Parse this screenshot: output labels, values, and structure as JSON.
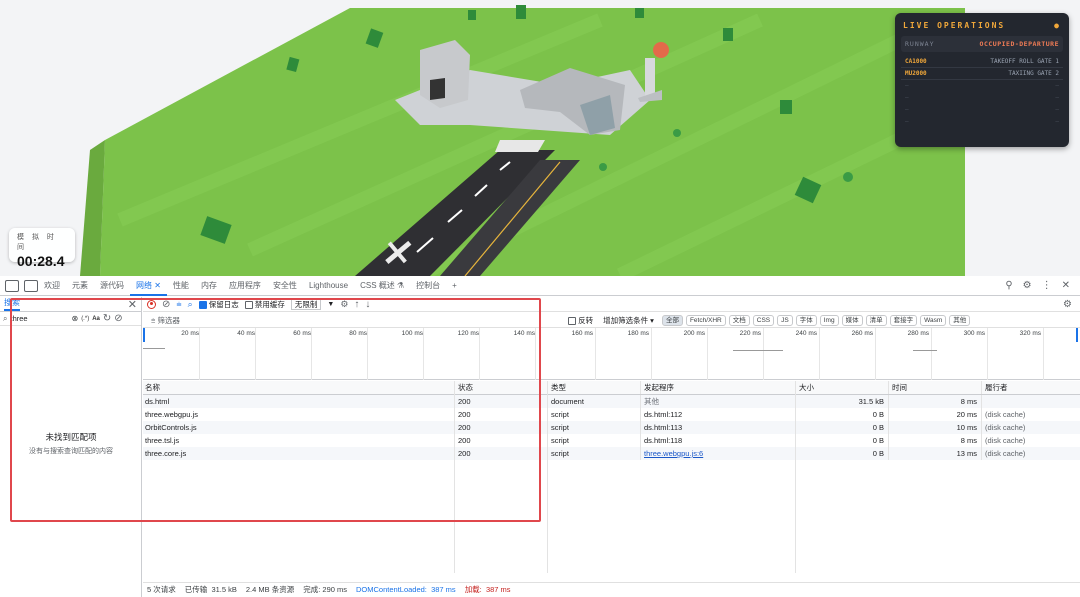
{
  "scene": {
    "sim_time_label": "模 拟 时 间",
    "sim_time_value": "00:28.4",
    "ops": {
      "title": "LIVE OPERATIONS",
      "runway_label": "RUNWAY",
      "runway_status": "OCCUPIED-DEPARTURE",
      "flights": [
        {
          "id": "CA1000",
          "status": "TAKEOFF ROLL GATE 1"
        },
        {
          "id": "MU2000",
          "status": "TAXIING GATE 2"
        }
      ],
      "empty_slot": "—",
      "empty_slot_right": "—"
    },
    "colors": {
      "grass": "#7cc24a",
      "runway": "#2f2f33",
      "panel": "#23272f",
      "accent": "#f0a73a"
    }
  },
  "devtools": {
    "tabs": [
      "欢迎",
      "元素",
      "源代码",
      "网络",
      "性能",
      "内存",
      "应用程序",
      "安全性",
      "Lighthouse",
      "CSS 概述",
      "控制台"
    ],
    "active_tab_index": 3,
    "search": {
      "title": "搜索",
      "query": "three",
      "regex": "(.*)",
      "case": "Aa",
      "empty_title": "未找到匹配项",
      "empty_desc": "没有与搜索查询匹配的内容"
    },
    "toolbar": {
      "preserve_log": "保留日志",
      "disable_cache": "禁用缓存",
      "throttle": "无限制"
    },
    "filter": {
      "placeholder": "筛选器",
      "invert": "反转",
      "more_filters": "增加筛选条件",
      "chips": [
        "全部",
        "Fetch/XHR",
        "文档",
        "CSS",
        "JS",
        "字体",
        "Img",
        "媒体",
        "清单",
        "套接字",
        "Wasm",
        "其他"
      ]
    },
    "timeline_ticks": [
      "20 ms",
      "40 ms",
      "60 ms",
      "80 ms",
      "100 ms",
      "120 ms",
      "140 ms",
      "160 ms",
      "180 ms",
      "200 ms",
      "220 ms",
      "240 ms",
      "260 ms",
      "280 ms",
      "300 ms",
      "320 ms"
    ],
    "columns": {
      "name": "名称",
      "status": "状态",
      "type": "类型",
      "initiator": "发起程序",
      "size": "大小",
      "time": "时间",
      "fulfilled": "履行者"
    },
    "rows": [
      {
        "name": "ds.html",
        "status": "200",
        "type": "document",
        "initiator": "其他",
        "size": "31.5 kB",
        "time": "8 ms",
        "fulfilled": ""
      },
      {
        "name": "three.webgpu.js",
        "status": "200",
        "type": "script",
        "initiator": "ds.html:112",
        "size": "0 B",
        "time": "20 ms",
        "fulfilled": "(disk cache)"
      },
      {
        "name": "OrbitControls.js",
        "status": "200",
        "type": "script",
        "initiator": "ds.html:113",
        "size": "0 B",
        "time": "10 ms",
        "fulfilled": "(disk cache)"
      },
      {
        "name": "three.tsl.js",
        "status": "200",
        "type": "script",
        "initiator": "ds.html:118",
        "size": "0 B",
        "time": "8 ms",
        "fulfilled": "(disk cache)"
      },
      {
        "name": "three.core.js",
        "status": "200",
        "type": "script",
        "initiator": "three.webgpu.js:6",
        "size": "0 B",
        "time": "13 ms",
        "fulfilled": "(disk cache)"
      }
    ],
    "status_bar": {
      "requests": "5 次请求",
      "transferred": "已传输",
      "transferred_val": "31.5 kB",
      "resources": "2.4 MB 条资源",
      "finish": "完成:",
      "finish_val": "290 ms",
      "dcl": "DOMContentLoaded:",
      "dcl_val": "387 ms",
      "load": "加载:",
      "load_val": "387 ms"
    }
  }
}
